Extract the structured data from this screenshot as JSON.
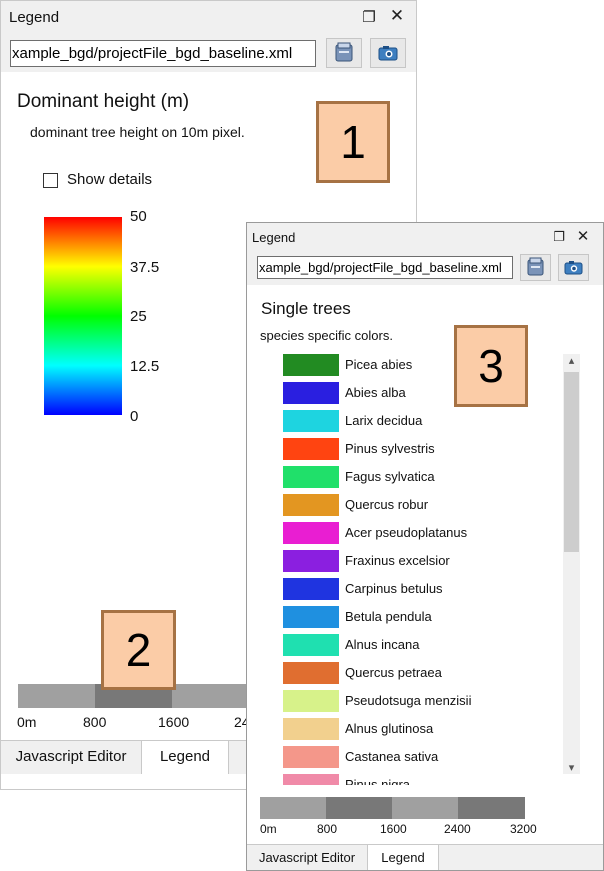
{
  "panel1": {
    "title": "Legend",
    "path": "xample_bgd/projectFile_bgd_baseline.xml",
    "legend_title": "Dominant height (m)",
    "description": "dominant tree height on 10m pixel.",
    "show_details_label": "Show details",
    "show_details_checked": false,
    "gradient_labels": [
      "50",
      "37.5",
      "25",
      "12.5",
      "0"
    ],
    "gradient_colors": [
      "#ff0000",
      "#ffff00",
      "#00ff00",
      "#00ffff",
      "#0000ff"
    ],
    "scale_labels": [
      "0m",
      "800",
      "1600",
      "24"
    ],
    "tabs": [
      "Javascript Editor",
      "Legend"
    ],
    "active_tab": "Legend"
  },
  "panel3": {
    "title": "Legend",
    "path": "xample_bgd/projectFile_bgd_baseline.xml",
    "legend_title": "Single trees",
    "description": "species specific colors.",
    "species": [
      {
        "name": "Picea abies",
        "color": "#228b22"
      },
      {
        "name": "Abies alba",
        "color": "#2a1fe0"
      },
      {
        "name": "Larix decidua",
        "color": "#1ed4e0"
      },
      {
        "name": "Pinus sylvestris",
        "color": "#ff4411"
      },
      {
        "name": "Fagus sylvatica",
        "color": "#20e06a"
      },
      {
        "name": "Quercus robur",
        "color": "#e39621"
      },
      {
        "name": "Acer pseudoplatanus",
        "color": "#e91ed2"
      },
      {
        "name": "Fraxinus excelsior",
        "color": "#8b1fe0"
      },
      {
        "name": "Carpinus betulus",
        "color": "#1f34e0"
      },
      {
        "name": "Betula pendula",
        "color": "#1f90e0"
      },
      {
        "name": "Alnus incana",
        "color": "#1fe0b0"
      },
      {
        "name": "Quercus petraea",
        "color": "#e06e30"
      },
      {
        "name": "Pseudotsuga menzisii",
        "color": "#d7f28a"
      },
      {
        "name": "Alnus glutinosa",
        "color": "#f2d08e"
      },
      {
        "name": "Castanea sativa",
        "color": "#f4978a"
      },
      {
        "name": "Pinus nigra",
        "color": "#f08aa8"
      }
    ],
    "scale_labels": [
      "0m",
      "800",
      "1600",
      "2400",
      "3200"
    ],
    "tabs": [
      "Javascript Editor",
      "Legend"
    ],
    "active_tab": "Legend"
  },
  "callouts": [
    "1",
    "2",
    "3"
  ],
  "icons": {
    "title_float": "float-window-icon",
    "title_close": "close-icon",
    "open_file": "folder-open-icon",
    "screenshot": "camera-icon"
  },
  "colors": {
    "titlebar_bg": "#f0f0f0",
    "callout_fill": "#fbcca7",
    "callout_border": "#a67244",
    "scale_light": "#a0a0a0",
    "scale_dark": "#787878"
  }
}
